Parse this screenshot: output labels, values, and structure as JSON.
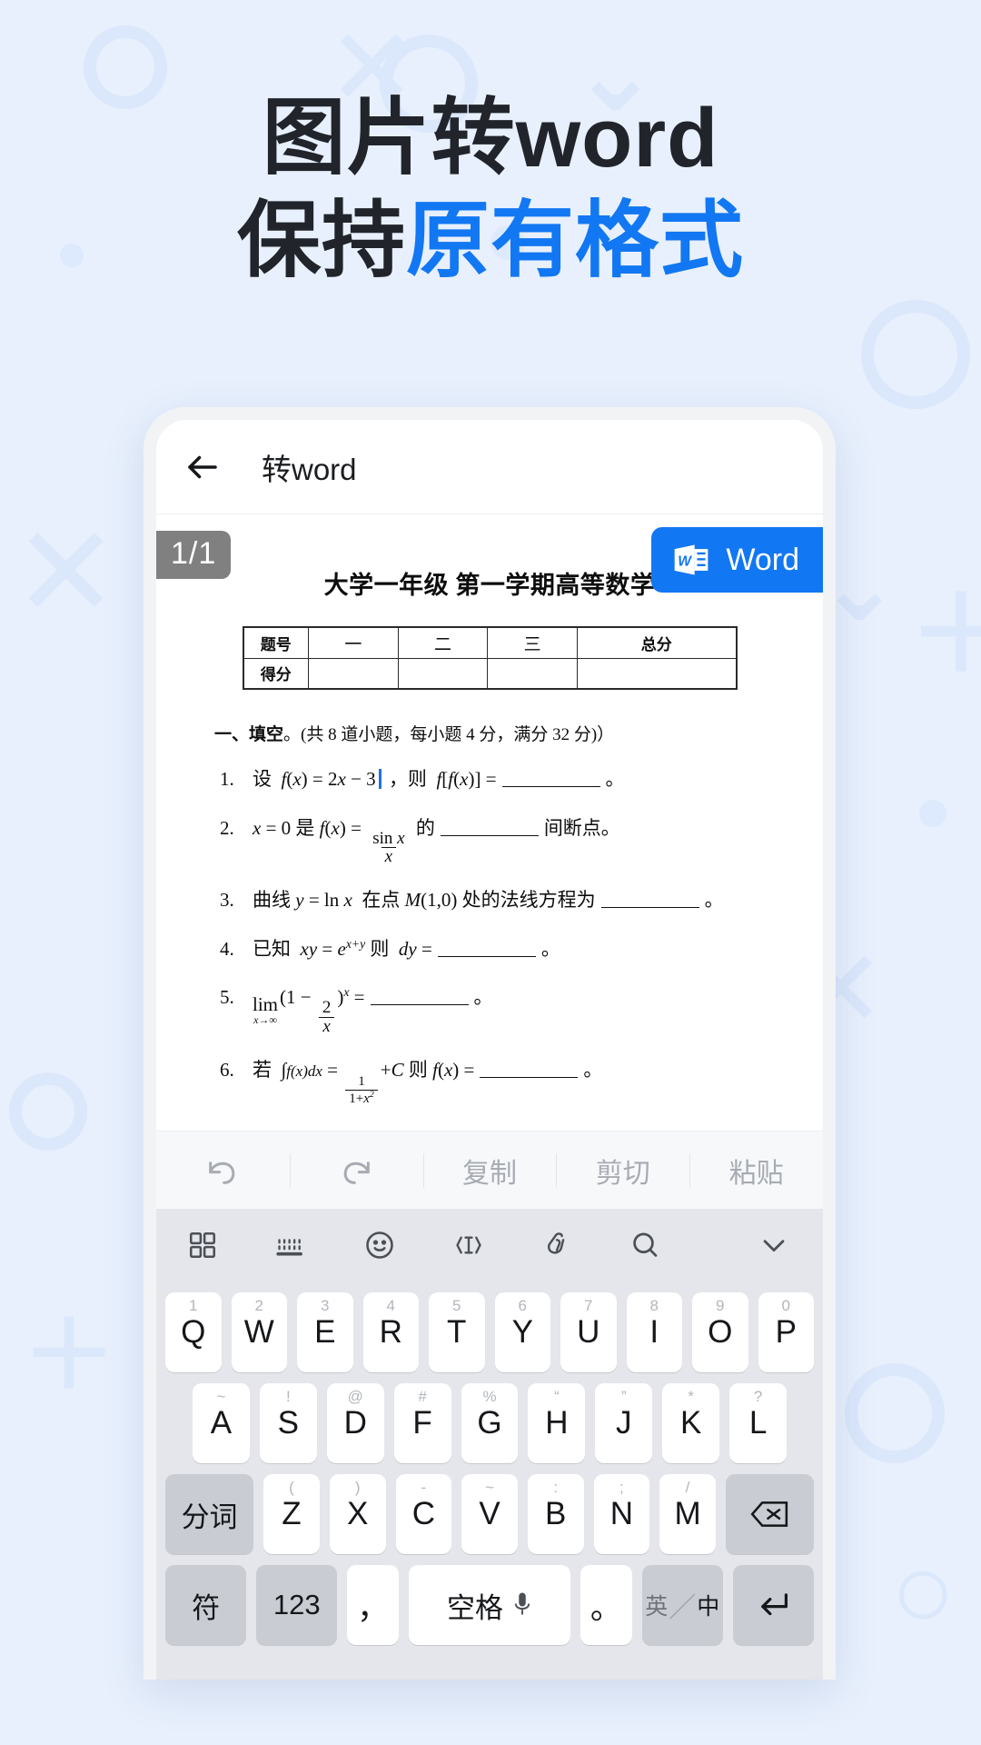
{
  "headline": {
    "line1": "图片转word",
    "line2_dark": "保持",
    "line2_accent": "原有格式",
    "accent_color": "#1277f2",
    "dark_color": "#21252b"
  },
  "phone": {
    "appbar": {
      "back_icon": "arrow-left-icon",
      "title": "转word"
    },
    "document": {
      "page_badge": "1/1",
      "word_button": {
        "label": "Word",
        "icon": "word-logo-icon",
        "color": "#1277f2"
      },
      "title": "大学一年级 第一学期高等数学",
      "score_table": {
        "rows": [
          {
            "header": "题号",
            "cells": [
              "一",
              "二",
              "三",
              "总分"
            ]
          },
          {
            "header": "得分",
            "cells": [
              "",
              "",
              "",
              ""
            ]
          }
        ]
      },
      "section_head": {
        "label": "一、填空",
        "note": "。(共 8 道小题，每小题 4 分，满分 32 分)）"
      },
      "questions": [
        {
          "index": "1.",
          "text": "设 f(x) = 2x − 3 ，则 f[f(x)] = ______ 。"
        },
        {
          "index": "2.",
          "text": "x = 0 是 f(x) = sin x / x 的 ______ 间断点。"
        },
        {
          "index": "3.",
          "text": "曲线 y = ln x 在点 M(1,0) 处的法线方程为 ______ 。"
        },
        {
          "index": "4.",
          "text": "已知 xy = e^(x+y) 则 dy = ______ 。"
        },
        {
          "index": "5.",
          "text": "lim(x→∞)(1 − 2/x)^x = ______ 。"
        },
        {
          "index": "6.",
          "text": "若 ∫f(x)dx = 1/(1+x²) + C 则 f(x) = ______ 。"
        }
      ]
    },
    "edit_toolbar": [
      {
        "name": "undo",
        "label": "",
        "icon": "undo-icon"
      },
      {
        "name": "redo",
        "label": "",
        "icon": "redo-icon"
      },
      {
        "name": "copy",
        "label": "复制",
        "icon": ""
      },
      {
        "name": "cut",
        "label": "剪切",
        "icon": ""
      },
      {
        "name": "paste",
        "label": "粘贴",
        "icon": ""
      }
    ],
    "keyboard": {
      "tools": [
        "grid-icon",
        "keyboard-icon",
        "emoji-icon",
        "text-cursor-icon",
        "clipboard-icon",
        "search-icon",
        "chevron-down-icon"
      ],
      "row1": [
        {
          "sup": "1",
          "key": "Q"
        },
        {
          "sup": "2",
          "key": "W"
        },
        {
          "sup": "3",
          "key": "E"
        },
        {
          "sup": "4",
          "key": "R"
        },
        {
          "sup": "5",
          "key": "T"
        },
        {
          "sup": "6",
          "key": "Y"
        },
        {
          "sup": "7",
          "key": "U"
        },
        {
          "sup": "8",
          "key": "I"
        },
        {
          "sup": "9",
          "key": "O"
        },
        {
          "sup": "0",
          "key": "P"
        }
      ],
      "row2": [
        {
          "sup": "~",
          "key": "A"
        },
        {
          "sup": "!",
          "key": "S"
        },
        {
          "sup": "@",
          "key": "D"
        },
        {
          "sup": "#",
          "key": "F"
        },
        {
          "sup": "%",
          "key": "G"
        },
        {
          "sup": "“",
          "key": "H"
        },
        {
          "sup": "”",
          "key": "J"
        },
        {
          "sup": "*",
          "key": "K"
        },
        {
          "sup": "?",
          "key": "L"
        }
      ],
      "row3_left": "分词",
      "row3": [
        {
          "sup": "(",
          "key": "Z"
        },
        {
          "sup": ")",
          "key": "X"
        },
        {
          "sup": "-",
          "key": "C"
        },
        {
          "sup": "~",
          "key": "V"
        },
        {
          "sup": ":",
          "key": "B"
        },
        {
          "sup": ";",
          "key": "N"
        },
        {
          "sup": "/",
          "key": "M"
        }
      ],
      "row3_right_icon": "backspace-icon",
      "row4": {
        "symbol": "符",
        "numbers": "123",
        "comma": "，",
        "space": "空格",
        "space_icon": "microphone-icon",
        "period": "。",
        "lang_en": "英",
        "lang_cn": "中",
        "enter_icon": "enter-icon"
      }
    }
  }
}
